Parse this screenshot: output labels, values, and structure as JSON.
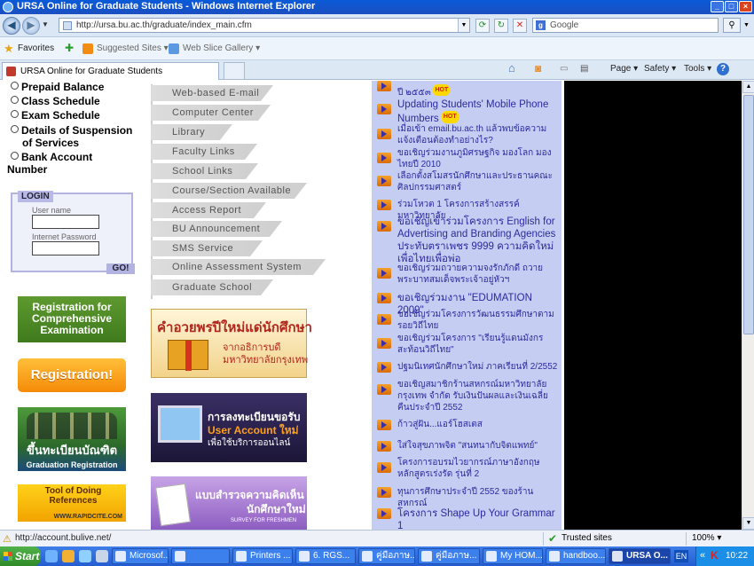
{
  "window": {
    "title": "URSA Online for Graduate Students - Windows Internet Explorer",
    "min": "_",
    "max": "□",
    "close": "×"
  },
  "address": {
    "url": "http://ursa.bu.ac.th/graduate/index_main.cfm",
    "search_placeholder": "Google",
    "search_engine_glyph": "g"
  },
  "favorites": {
    "label": "Favorites",
    "suggested": "Suggested Sites ▾",
    "slice": "Web Slice Gallery ▾"
  },
  "tab": {
    "label": "URSA Online for Graduate Students"
  },
  "commands": {
    "page": "Page ▾",
    "safety": "Safety ▾",
    "tools": "Tools ▾",
    "help": "?"
  },
  "left_menu": {
    "items": [
      "Prepaid Balance",
      "Class Schedule",
      "Exam Schedule",
      "Details of Suspension",
      "Bank Account"
    ],
    "item3_line2": "of Services",
    "item4_line2": "Number"
  },
  "login": {
    "tag": "LOGIN",
    "user_label": "User name",
    "pass_label": "Internet Password",
    "go": "GO!"
  },
  "banners": {
    "reg_comp": "Registration for Comprehensive Examination",
    "registration": "Registration!",
    "grad_th": "ขึ้นทะเบียนบัณฑิต",
    "grad_en": "Graduation Registration",
    "ref": "Tool of Doing References",
    "ref_site": "WWW.RAPIDCITE.COM"
  },
  "mid_nav": [
    "Web-based E-mail",
    "Computer Center",
    "Library",
    "Faculty Links",
    "School Links",
    "Course/Section Available",
    "Access Report",
    "BU Announcement",
    "SMS  Service",
    "Online Assessment System",
    "Graduate School"
  ],
  "promo": {
    "img1_line1": "คำอวยพรปีใหม่แด่นักศึกษา",
    "img1_line2": "จากอธิการบดี",
    "img1_line3": "มหาวิทยาลัยกรุงเทพ",
    "img2_line1": "การลงทะเบียนขอรับ",
    "img2_line2": "User Account ใหม่",
    "img2_line3": "เพื่อใช้บริการออนไลน์",
    "img3_line1": "แบบสำรวจความคิดเห็น",
    "img3_line2": "นักศึกษาใหม่",
    "img3_line3": "SURVEY FOR FRESHMEN"
  },
  "news": [
    "ปี ๒๕๕๓",
    "Updating Students' Mobile Phone Numbers",
    "เมื่อเข้า email.bu.ac.th แล้วพบข้อความแจ้งเตือนต้องทำอย่างไร?",
    "ขอเชิญร่วมงานภูมิศรษฐกิจ มองโลก มองไทยปี 2010",
    "เลือกตั้งสโมสรนักศึกษาและประธานคณะศิลปกรรมศาสตร์",
    "ร่วมโหวต 1 โครงการสร้างสรรค์มหาวิทยาลัย",
    "ขอเชิญเข้าร่วมโครงการ English for Advertising and Branding Agencies ประทับตราเพชร 9999 ความคิดใหม่ เพื่อไทยเพื่อพ่อ",
    "ขอเชิญร่วมถวายความจงรักภักดี ถวายพระบาทสมเด็จพระเจ้าอยู่หัวฯ",
    "ขอเชิญร่วมงาน \"EDUMATION 2009\"",
    "ขอเชิญร่วมโครงการวัฒนธรรมศึกษาตามรอยวิถีไทย",
    "ขอเชิญร่วมโครงการ \"เรียนรู้แดนมังกร สะท้อนวิถีไทย\"",
    "ปฐมนิเทศนักศึกษาใหม่ ภาคเรียนที่ 2/2552",
    "ขอเชิญสมาชิกร้านสหกรณ์มหาวิทยาลัยกรุงเทพ จำกัด รับเงินปันผลและเงินเฉลี่ยคืนประจำปี 2552",
    "ก้าวสู่ฝัน...แอร์โฮสเตส",
    "ใส่ใจสุขภาพจิต \"สนทนากับจิตแพทย์\"",
    "โครงการอบรมไวยากรณ์ภาษาอังกฤษหลักสูตรเร่งรัด รุ่นที่ 2",
    "ทุนการศึกษาประจำปี 2552 ของร้านสหกรณ์",
    "โครงการ Shape Up Your Grammar 1"
  ],
  "hot_badge": "HOT",
  "status": {
    "url": "http://account.bulive.net/",
    "zone": "Trusted sites",
    "zoom": "100% ▾"
  },
  "taskbar": {
    "start": "Start",
    "tasks": [
      "Microsof...",
      "",
      "Printers ...",
      "6.  RGS...",
      "คู่มือภาษ...",
      "คู่มือภาษ...",
      "My HOM...",
      "handboo...",
      "URSA O..."
    ],
    "lang": "EN",
    "clock": "10:22"
  },
  "colors": {
    "news_bg": "#c5cdf2",
    "news_text": "#2b2ba0",
    "titlebar": "#0a5ad8",
    "taskbar": "#245dd1"
  }
}
